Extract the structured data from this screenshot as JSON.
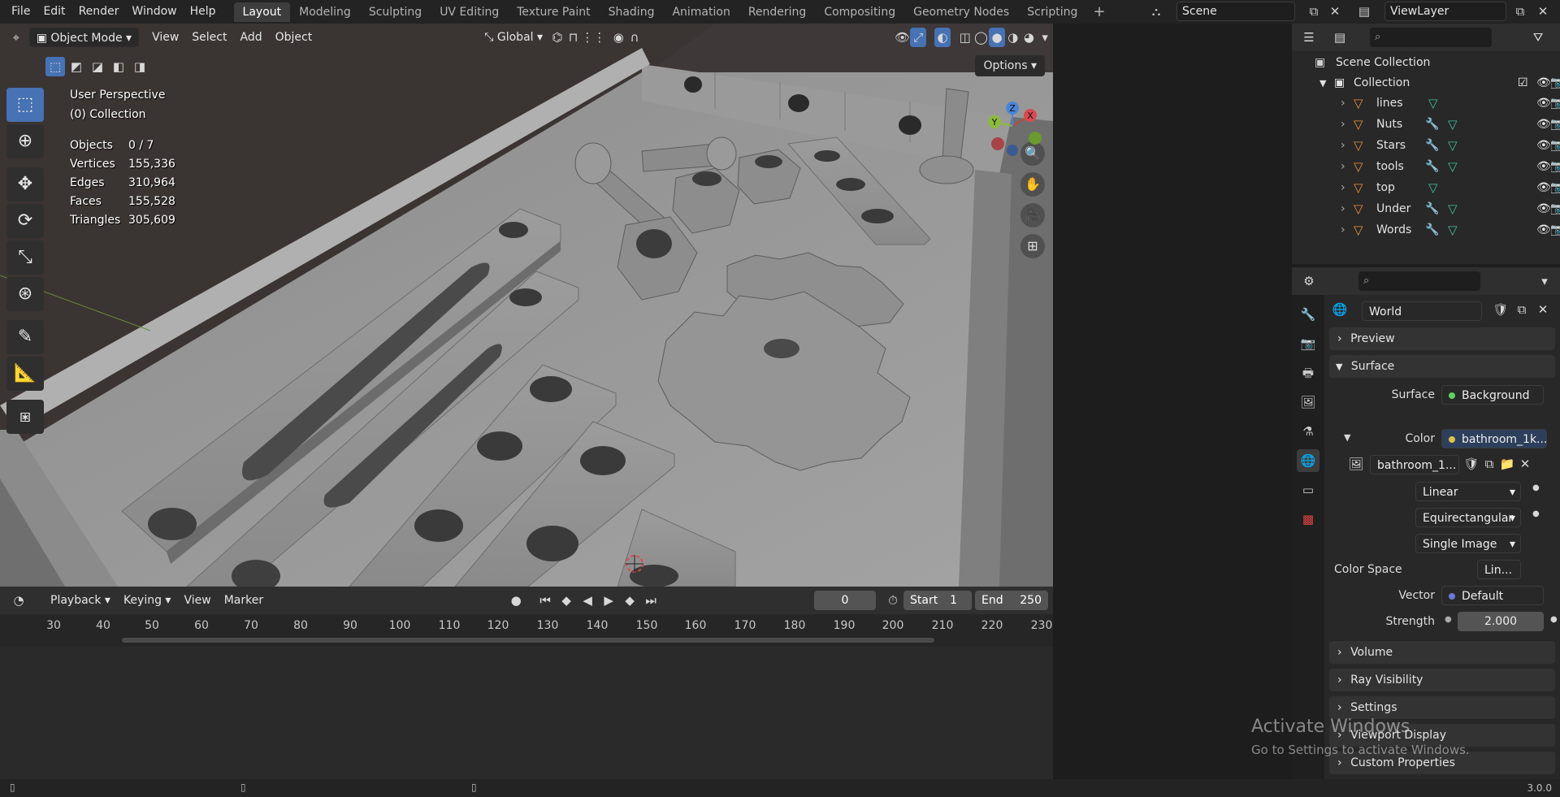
{
  "menu": [
    "File",
    "Edit",
    "Render",
    "Window",
    "Help"
  ],
  "workspaces": [
    "Layout",
    "Modeling",
    "Sculpting",
    "UV Editing",
    "Texture Paint",
    "Shading",
    "Animation",
    "Rendering",
    "Compositing",
    "Geometry Nodes",
    "Scripting"
  ],
  "active_workspace": "Layout",
  "scene_name": "Scene",
  "view_layer": "ViewLayer",
  "viewport": {
    "mode": "Object Mode",
    "menus": [
      "View",
      "Select",
      "Add",
      "Object"
    ],
    "orientation": "Global",
    "options_label": "Options",
    "perspective_label": "User Perspective",
    "collection_label": "(0) Collection",
    "stats": [
      {
        "key": "Objects",
        "value": "0 / 7"
      },
      {
        "key": "Vertices",
        "value": "155,336"
      },
      {
        "key": "Edges",
        "value": "310,964"
      },
      {
        "key": "Faces",
        "value": "155,528"
      },
      {
        "key": "Triangles",
        "value": "305,609"
      }
    ],
    "gizmo": {
      "x": "X",
      "y": "Y",
      "z": "Z"
    }
  },
  "timeline": {
    "menus": [
      "Playback",
      "Keying",
      "View",
      "Marker"
    ],
    "current_frame": "0",
    "start_label": "Start",
    "start": "1",
    "end_label": "End",
    "end": "250",
    "ticks": [
      "30",
      "40",
      "50",
      "60",
      "70",
      "80",
      "90",
      "100",
      "110",
      "120",
      "130",
      "140",
      "150",
      "160",
      "170",
      "180",
      "190",
      "200",
      "210",
      "220",
      "230"
    ]
  },
  "outliner": {
    "root": "Scene Collection",
    "collection": "Collection",
    "objects": [
      {
        "name": "lines",
        "modifier": false
      },
      {
        "name": "Nuts",
        "modifier": true
      },
      {
        "name": "Stars",
        "modifier": true
      },
      {
        "name": "tools",
        "modifier": true
      },
      {
        "name": "top",
        "modifier": false
      },
      {
        "name": "Under",
        "modifier": true
      },
      {
        "name": "Words",
        "modifier": true
      }
    ]
  },
  "properties": {
    "world_name": "World",
    "panels": {
      "preview": "Preview",
      "surface": "Surface",
      "volume": "Volume",
      "ray_visibility": "Ray Visibility",
      "settings": "Settings",
      "viewport_display": "Viewport Display",
      "custom_properties": "Custom Properties"
    },
    "surface_label": "Surface",
    "surface_value": "Background",
    "color_label": "Color",
    "color_value": "bathroom_1k....",
    "image_name": "bathroom_1...",
    "interpolation": "Linear",
    "projection": "Equirectangular",
    "source": "Single Image",
    "color_space_label": "Color Space",
    "color_space_value": "Lin...",
    "vector_label": "Vector",
    "vector_value": "Default",
    "strength_label": "Strength",
    "strength_value": "2.000"
  },
  "watermark": {
    "title": "Activate Windows",
    "subtitle": "Go to Settings to activate Windows."
  },
  "version": "3.0.0",
  "colors": {
    "accent": "#4772b3",
    "object_icon": "#e8913a",
    "data_icon": "#3fbf9c",
    "modifier_icon": "#5a9bea"
  }
}
